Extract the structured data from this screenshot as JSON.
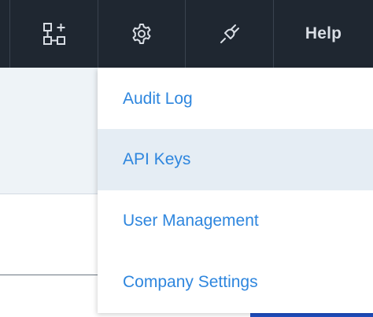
{
  "topbar": {
    "icons": [
      "workflow-add-icon",
      "gear-icon",
      "plug-icon"
    ],
    "help_label": "Help"
  },
  "dropdown": {
    "items": [
      {
        "label": "Audit Log",
        "active": false
      },
      {
        "label": "API Keys",
        "active": true
      },
      {
        "label": "User Management",
        "active": false
      },
      {
        "label": "Company Settings",
        "active": false
      }
    ]
  },
  "colors": {
    "topbar_bg": "#1f2731",
    "menu_text": "#2e86de",
    "menu_active_bg": "#e5edf4"
  }
}
